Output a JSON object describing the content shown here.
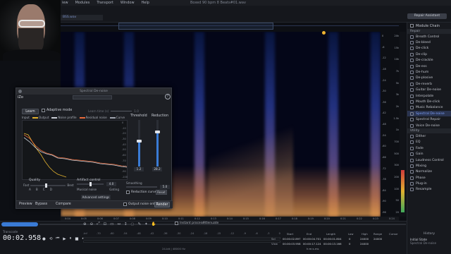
{
  "menubar": {
    "items": [
      "iew",
      "Modules",
      "Transport",
      "Window",
      "Help"
    ]
  },
  "window_title": "Boxed 90 bpm 8 Beats#01.wav",
  "file_tab": "BSS.wav",
  "repair_assistant": "Repair Assistant",
  "db_scale": [
    "0",
    "-6",
    "-12",
    "-18",
    "-24",
    "-30",
    "-36",
    "-42",
    "-48",
    "-54",
    "-60",
    "-66",
    "-72",
    "-78",
    "-84",
    "-90",
    "-96"
  ],
  "hz_scale": [
    "20k",
    "15k",
    "10k",
    "7k",
    "5k",
    "3k",
    "2k",
    "1.5k",
    "1k",
    "700",
    "500",
    "300",
    "200",
    "100",
    "50",
    "20"
  ],
  "time_ruler": [
    "0:04",
    "0:05",
    "0:06",
    "0:07",
    "0:08",
    "0:09",
    "0:10",
    "0:11",
    "0:12",
    "0:13",
    "0:14",
    "0:15",
    "0:16",
    "0:17",
    "0:18",
    "0:19",
    "0:20",
    "0:21",
    "0:22",
    "0:23",
    "0:24"
  ],
  "modules": {
    "chain_label": "Module Chain",
    "repair_group": "Repair",
    "repair_items": [
      "Breath Control",
      "De-bleed",
      "De-click",
      "De-clip",
      "De-crackle",
      "De-ess",
      "De-hum",
      "De-plosive",
      "De-reverb",
      "Guitar De-noise",
      "Interpolate",
      "Mouth De-click",
      "Music Rebalance",
      "Spectral De-noise",
      "Spectral Repair",
      "Voice De-noise"
    ],
    "selected": "Spectral De-noise",
    "utility_group": "Utility",
    "utility_items": [
      "Dither",
      "EQ",
      "Fade",
      "Gain",
      "Loudness Control",
      "Mixing",
      "Normalize",
      "Phase",
      "Plug-in",
      "Resample"
    ]
  },
  "plugin": {
    "title": "Spectral De-noise",
    "logo": "iZo",
    "learn_button": "Learn",
    "adaptive_mode": "Adaptive mode",
    "learn_time_label": "Learn time (s)",
    "learn_time_value": "1.0",
    "legend": {
      "input": "Input",
      "output": "Output",
      "noise_profile": "Noise profile",
      "residual_noise": "Residual noise",
      "curve": "Curve"
    },
    "graph_db": [
      "0",
      "-10",
      "-20",
      "-30",
      "-40",
      "-50",
      "-60",
      "-70",
      "-80",
      "-90",
      "-100"
    ],
    "threshold_label": "Threshold",
    "threshold_value": "1.2",
    "threshold_level": 0.55,
    "reduction_label": "Reduction",
    "reduction_value": "28.2",
    "reduction_level": 0.75,
    "smoothing_label": "Smoothing",
    "smoothing_value": "5.0",
    "reduction_curve": "Reduction curve",
    "reset": "Reset",
    "quality_label": "Quality",
    "quality_fast": "Fast",
    "quality_best": "Best",
    "quality_letters": [
      "A",
      "B",
      "C",
      "D"
    ],
    "artifact_label": "Artifact control",
    "artifact_value": "4.0",
    "artifact_musical": "Musical noise",
    "artifact_gating": "Gating",
    "advanced_settings": "Advanced settings",
    "preview": "Preview",
    "bypass": "Bypass",
    "compare": "Compare",
    "output_noise_only": "Output noise only",
    "render": "Render"
  },
  "transport": {
    "instant_process": "Instant process",
    "attenuate": "Attenuate",
    "timecode_label": "Transcode",
    "timecode": "00:02.958"
  },
  "level_scale": [
    "-Inf",
    "-70",
    "-60",
    "-54",
    "-48",
    "-42",
    "-36",
    "-30",
    "-24",
    "-18",
    "-15",
    "-12",
    "-9",
    "-6",
    "-3",
    "0"
  ],
  "format": "24-bit | 48000 Hz",
  "selection": {
    "headers": [
      "Start",
      "End",
      "Length",
      "Low",
      "High",
      "Range",
      "Cursor"
    ],
    "sel_label": "Sel",
    "view_label": "View",
    "sel_start": "00:00:02.897",
    "sel_end": "00:00:04.701",
    "sel_length": "00:00:01.804",
    "view_start": "00:00:03.958",
    "view_end": "00:00:17.124",
    "view_length": "00:00:13.166",
    "low": "0",
    "high": "24000",
    "range": "24000",
    "time_format": "h:m:s.ms",
    "zero": "0",
    "top": "24000"
  },
  "history": {
    "title": "History",
    "initial": "Initial State",
    "prev": "Spectral De-noise"
  },
  "colors": {
    "accent": "#3a7bd5",
    "output_curve": "#e0b02f",
    "noise_curve": "#c8ccd4",
    "residual": "#e86a3a",
    "selected": "#7fa3ff",
    "marker": "#f0b430"
  }
}
